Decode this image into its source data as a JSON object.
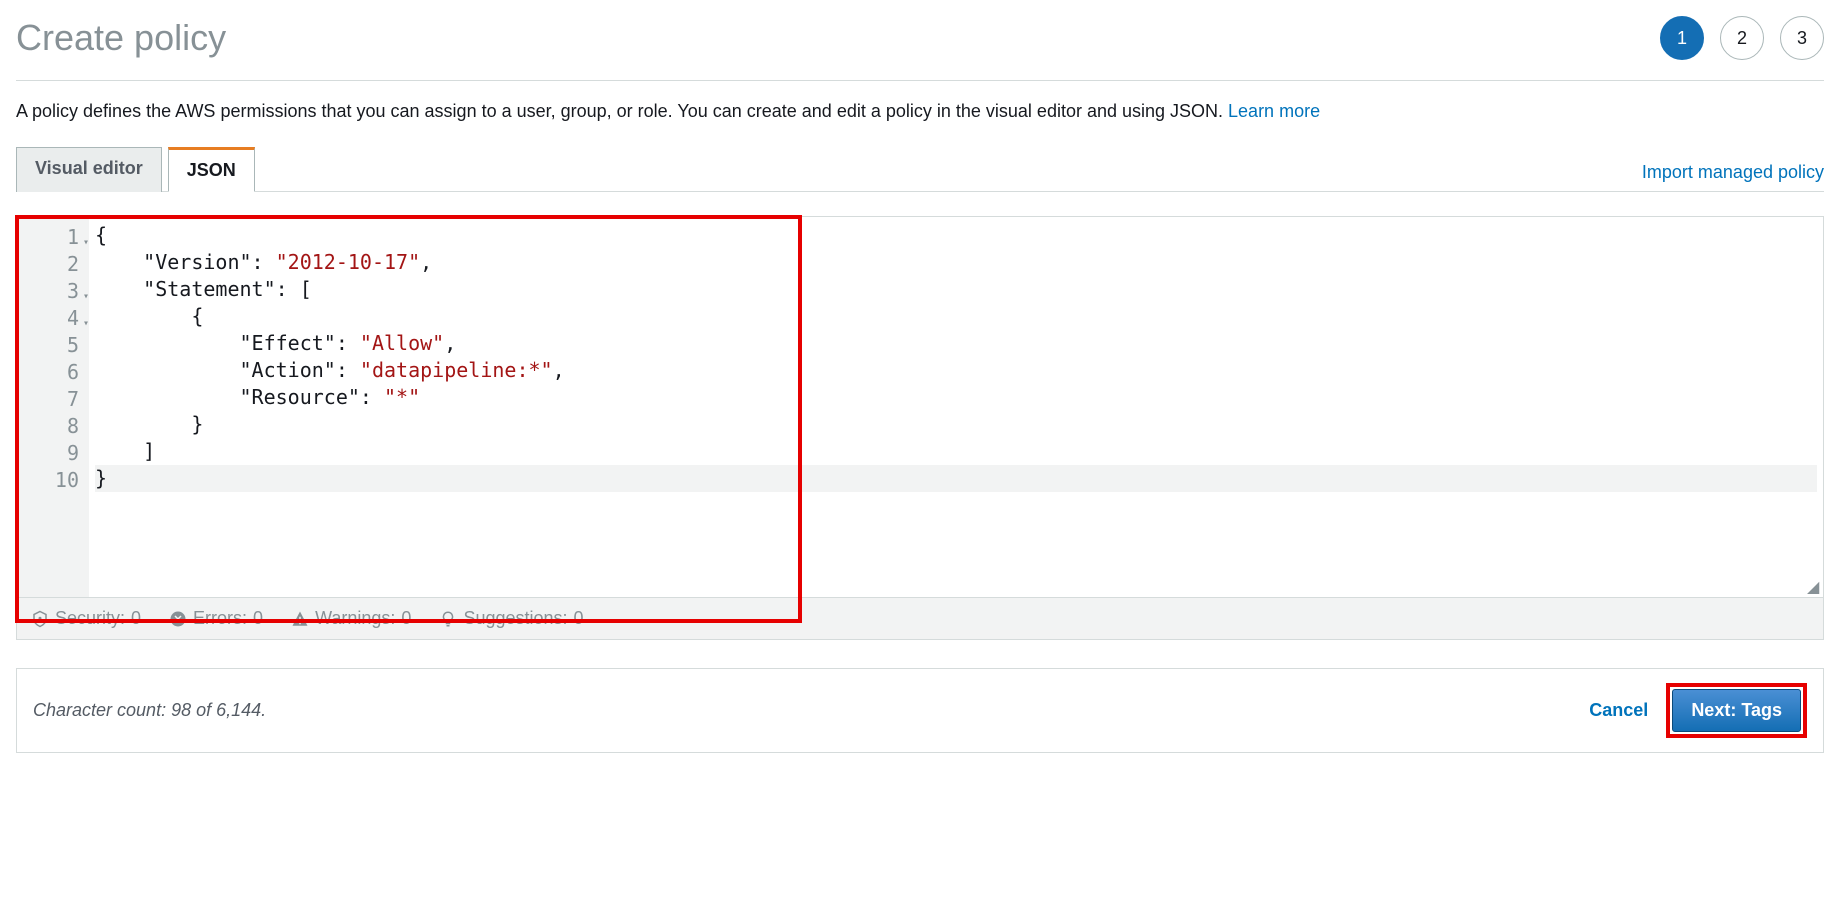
{
  "title": "Create policy",
  "steps": [
    "1",
    "2",
    "3"
  ],
  "active_step": 0,
  "description_text": "A policy defines the AWS permissions that you can assign to a user, group, or role. You can create and edit a policy in the visual editor and using JSON. ",
  "description_link": "Learn more",
  "tabs": {
    "visual": "Visual editor",
    "json": "JSON"
  },
  "active_tab": "json",
  "import_link": "Import managed policy",
  "code_lines": [
    {
      "n": "1",
      "fold": true,
      "segments": [
        {
          "t": "{",
          "c": "pun"
        }
      ]
    },
    {
      "n": "2",
      "fold": false,
      "segments": [
        {
          "t": "    ",
          "c": "pun"
        },
        {
          "t": "\"Version\"",
          "c": "key"
        },
        {
          "t": ": ",
          "c": "pun"
        },
        {
          "t": "\"2012-10-17\"",
          "c": "str"
        },
        {
          "t": ",",
          "c": "pun"
        }
      ]
    },
    {
      "n": "3",
      "fold": true,
      "segments": [
        {
          "t": "    ",
          "c": "pun"
        },
        {
          "t": "\"Statement\"",
          "c": "key"
        },
        {
          "t": ": [",
          "c": "pun"
        }
      ]
    },
    {
      "n": "4",
      "fold": true,
      "segments": [
        {
          "t": "        {",
          "c": "pun"
        }
      ]
    },
    {
      "n": "5",
      "fold": false,
      "segments": [
        {
          "t": "            ",
          "c": "pun"
        },
        {
          "t": "\"Effect\"",
          "c": "key"
        },
        {
          "t": ": ",
          "c": "pun"
        },
        {
          "t": "\"Allow\"",
          "c": "str"
        },
        {
          "t": ",",
          "c": "pun"
        }
      ]
    },
    {
      "n": "6",
      "fold": false,
      "segments": [
        {
          "t": "            ",
          "c": "pun"
        },
        {
          "t": "\"Action\"",
          "c": "key"
        },
        {
          "t": ": ",
          "c": "pun"
        },
        {
          "t": "\"datapipeline:*\"",
          "c": "str"
        },
        {
          "t": ",",
          "c": "pun"
        }
      ]
    },
    {
      "n": "7",
      "fold": false,
      "segments": [
        {
          "t": "            ",
          "c": "pun"
        },
        {
          "t": "\"Resource\"",
          "c": "key"
        },
        {
          "t": ": ",
          "c": "pun"
        },
        {
          "t": "\"*\"",
          "c": "str"
        }
      ]
    },
    {
      "n": "8",
      "fold": false,
      "segments": [
        {
          "t": "        }",
          "c": "pun"
        }
      ]
    },
    {
      "n": "9",
      "fold": false,
      "segments": [
        {
          "t": "    ]",
          "c": "pun"
        }
      ]
    },
    {
      "n": "10",
      "fold": false,
      "segments": [
        {
          "t": "}",
          "c": "pun"
        }
      ],
      "highlight": true
    }
  ],
  "status": {
    "security_label": "Security:",
    "security_count": "0",
    "errors_label": "Errors:",
    "errors_count": "0",
    "warnings_label": "Warnings:",
    "warnings_count": "0",
    "suggestions_label": "Suggestions:",
    "suggestions_count": "0"
  },
  "char_count": "Character count: 98 of 6,144.",
  "cancel": "Cancel",
  "next_button": "Next: Tags"
}
